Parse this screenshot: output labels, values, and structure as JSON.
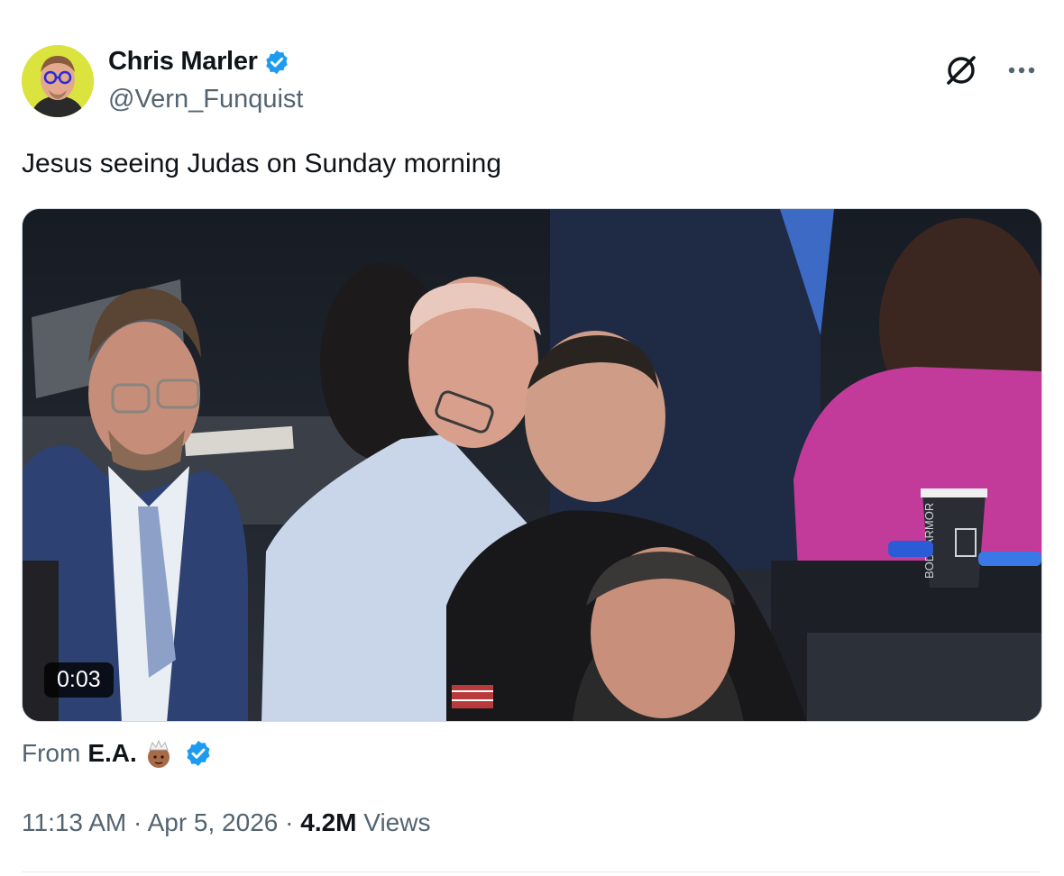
{
  "author": {
    "display_name": "Chris Marler",
    "handle": "@Vern_Funquist",
    "verified": true,
    "avatar_icon": "avatar-man-glasses"
  },
  "header_actions": {
    "grok_icon": "grok-icon",
    "more_icon": "more-icon"
  },
  "tweet": {
    "text": "Jesus seeing Judas on Sunday morning"
  },
  "media": {
    "type": "video",
    "duration": "0:03",
    "scene_text": "BODYARMOR"
  },
  "attribution": {
    "prefix": "From",
    "source_name": "E.A.",
    "emoji_icon": "man-with-crown-emoji",
    "verified": true
  },
  "meta": {
    "time": "11:13 AM",
    "separator": "·",
    "date": "Apr 5, 2026",
    "views_count": "4.2M",
    "views_label": "Views"
  },
  "colors": {
    "verified_blue": "#1d9bf0",
    "secondary_text": "#536471",
    "primary_text": "#0f1419"
  }
}
